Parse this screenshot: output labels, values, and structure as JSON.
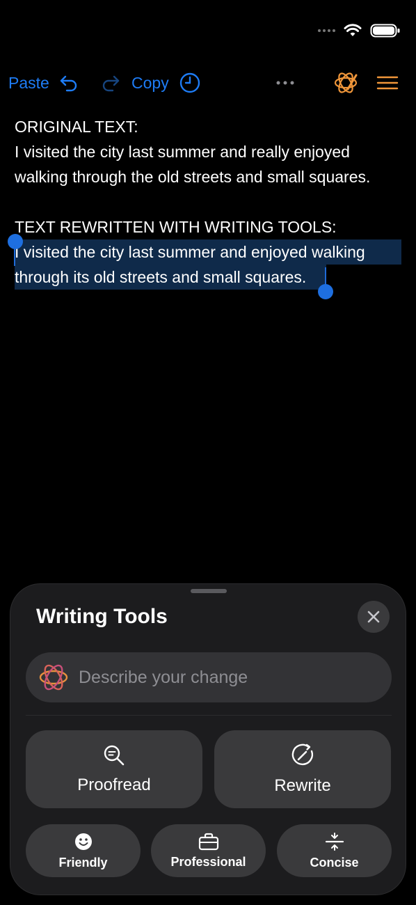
{
  "status_bar": {
    "signal_icon": "signal-dots-icon",
    "wifi_icon": "wifi-icon",
    "battery_icon": "battery-icon"
  },
  "toolbar": {
    "paste_label": "Paste",
    "copy_label": "Copy",
    "undo_icon": "undo-arrow-icon",
    "redo_icon": "redo-arrow-icon",
    "history_icon": "clock-icon",
    "more_icon": "ellipsis-icon",
    "writing_tools_icon": "writing-tools-icon",
    "menu_icon": "menu-lines-icon",
    "accent_color": "#1e7cf5",
    "orange_color": "#f0963a"
  },
  "document": {
    "original_heading": "ORIGINAL TEXT:",
    "original_line1": "I visited the city last summer and really enjoyed",
    "original_line2": "walking through the old streets and small squares.",
    "rewritten_heading": "TEXT REWRITTEN WITH WRITING TOOLS:",
    "rewritten_line1": "I visited the city last summer and enjoyed walking",
    "rewritten_line2": "through its old streets and small squares."
  },
  "writing_tools": {
    "title": "Writing Tools",
    "close_icon": "close-icon",
    "prompt_placeholder": "Describe your change",
    "prompt_icon": "apple-intelligence-icon",
    "proofread_label": "Proofread",
    "proofread_icon": "magnifier-check-icon",
    "rewrite_label": "Rewrite",
    "rewrite_icon": "rewrite-circle-icon",
    "friendly_label": "Friendly",
    "friendly_icon": "smiley-icon",
    "professional_label": "Professional",
    "professional_icon": "briefcase-icon",
    "concise_label": "Concise",
    "concise_icon": "compress-icon"
  }
}
